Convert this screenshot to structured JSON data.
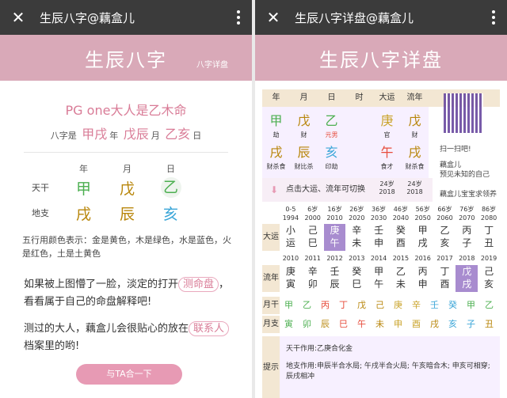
{
  "left": {
    "title": "生辰八字@藕盒儿",
    "banner": "生辰八字",
    "banner_small": "八字详盘",
    "headline": "PG one大人是乙木命",
    "bazi_label": "八字是",
    "bazi": [
      {
        "big": "甲戌",
        "small": "年"
      },
      {
        "big": "戊辰",
        "small": "月"
      },
      {
        "big": "乙亥",
        "small": "日"
      }
    ],
    "cols": [
      "年",
      "月",
      "日"
    ],
    "row1_label": "天干",
    "row1": [
      "甲",
      "戊",
      "乙"
    ],
    "row2_label": "地支",
    "row2": [
      "戌",
      "辰",
      "亥"
    ],
    "note": "五行用颜色表示：金是黄色，木是绿色，水是蓝色，火是红色，土是土黄色",
    "para1_a": "如果被上图懵了一脸，淡定的打开",
    "para1_pill": "测命盘",
    "para1_b": "，看看属于自己的命盘解释吧!",
    "para2_a": "测过的大人，藕盒儿会很贴心的放在",
    "para2_pill": "联系人",
    "para2_b": "档案里的哟!",
    "button": "与TA合一下"
  },
  "right": {
    "title": "生辰八字详盘@藕盒儿",
    "banner": "生辰八字详盘",
    "headers": [
      "年",
      "月",
      "日",
      "时",
      "大运",
      "流年"
    ],
    "stems": [
      "甲",
      "戊",
      "乙",
      "",
      "庚",
      "戊"
    ],
    "stem_roles": [
      "劫",
      "财",
      "元男",
      "",
      "官",
      "财"
    ],
    "branches": [
      "戌",
      "辰",
      "亥",
      "",
      "午",
      "戌"
    ],
    "branch_roles": [
      "财杀食",
      "财比杀",
      "印劫",
      "",
      "食才",
      "财杀食"
    ],
    "dayun_age": "24岁",
    "dayun_year": "2018",
    "liunian_age": "24岁",
    "liunian_year": "2018",
    "qr_l1": "扫一扫吧!",
    "qr_l2": "藕盒儿",
    "qr_l3": "预见未知的自己",
    "qr_l4": "藕盒儿宝宝求领养",
    "tip_bar": "点击大运、流年可切换",
    "ages": [
      "0-5",
      "6岁",
      "16岁",
      "26岁",
      "36岁",
      "46岁",
      "56岁",
      "66岁",
      "76岁",
      "86岁"
    ],
    "age_years": [
      "1994",
      "2000",
      "2010",
      "2020",
      "2030",
      "2040",
      "2050",
      "2060",
      "2070",
      "2080"
    ],
    "dayun_label": "大运",
    "dayun_top": [
      "小",
      "己",
      "庚",
      "辛",
      "壬",
      "癸",
      "甲",
      "乙",
      "丙",
      "丁"
    ],
    "dayun_bot": [
      "运",
      "巳",
      "午",
      "未",
      "申",
      "酉",
      "戌",
      "亥",
      "子",
      "丑"
    ],
    "ln_years": [
      "2010",
      "2011",
      "2012",
      "2013",
      "2014",
      "2015",
      "2016",
      "2017",
      "2018",
      "2019"
    ],
    "liunian_label": "流年",
    "ln_top": [
      "庚",
      "辛",
      "壬",
      "癸",
      "甲",
      "乙",
      "丙",
      "丁",
      "戊",
      "己"
    ],
    "ln_bot": [
      "寅",
      "卯",
      "辰",
      "巳",
      "午",
      "未",
      "申",
      "酉",
      "戌",
      "亥"
    ],
    "yuegan_label": "月干",
    "yuegan": [
      "甲",
      "乙",
      "丙",
      "丁",
      "戊",
      "己",
      "庚",
      "辛",
      "壬",
      "癸",
      "甲",
      "乙"
    ],
    "yuezhi_label": "月支",
    "yuezhi": [
      "寅",
      "卯",
      "辰",
      "巳",
      "午",
      "未",
      "申",
      "酉",
      "戌",
      "亥",
      "子",
      "丑"
    ],
    "tip_label": "提示",
    "tip1": "天干作用:乙庚合化金",
    "tip2": "地支作用:申辰半合水局; 午戌半合火局; 午亥暗合木; 申亥可相穿; 辰戌相冲"
  }
}
